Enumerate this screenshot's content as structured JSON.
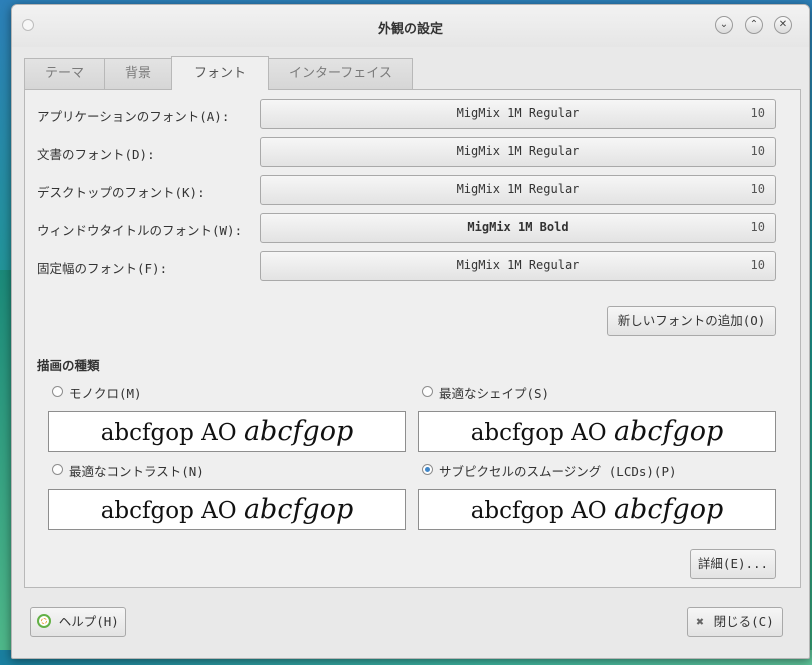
{
  "window": {
    "title": "外観の設定",
    "controls": [
      "⌄",
      "⌃",
      "✕"
    ]
  },
  "tabs": [
    {
      "label": "テーマ",
      "active": false
    },
    {
      "label": "背景",
      "active": false
    },
    {
      "label": "フォント",
      "active": true
    },
    {
      "label": "インターフェイス",
      "active": false
    }
  ],
  "fonts": {
    "rows": [
      {
        "label": "アプリケーションのフォント(A):",
        "font": "MigMix 1M Regular",
        "size": "10"
      },
      {
        "label": "文書のフォント(D):",
        "font": "MigMix 1M Regular",
        "size": "10"
      },
      {
        "label": "デスクトップのフォント(K):",
        "font": "MigMix 1M Regular",
        "size": "10"
      },
      {
        "label": "ウィンドウタイトルのフォント(W):",
        "font": "MigMix 1M Bold",
        "size": "10"
      },
      {
        "label": "固定幅のフォント(F):",
        "font": "MigMix 1M Regular",
        "size": "10"
      }
    ],
    "add_button": "新しいフォントの追加(O)"
  },
  "rendering": {
    "title": "描画の種類",
    "options": [
      {
        "label": "モノクロ(M)",
        "checked": false,
        "preview": {
          "normal": "abcfgop AO",
          "italic": "abcfgop"
        }
      },
      {
        "label": "最適なシェイプ(S)",
        "checked": false,
        "preview": {
          "normal": "abcfgop AO",
          "italic": "abcfgop"
        }
      },
      {
        "label": "最適なコントラスト(N)",
        "checked": false,
        "preview": {
          "normal": "abcfgop AO",
          "italic": "abcfgop"
        }
      },
      {
        "label": "サブピクセルのスムージング (LCDs)(P)",
        "checked": true,
        "preview": {
          "normal": "abcfgop AO",
          "italic": "abcfgop"
        }
      }
    ],
    "details_button": "詳細(E)..."
  },
  "footer": {
    "help_button": "ヘルプ(H)",
    "close_button": "閉じる(C)"
  },
  "colors": {
    "radio_checked": "#3f86c8",
    "help_icon": "#63b046"
  }
}
